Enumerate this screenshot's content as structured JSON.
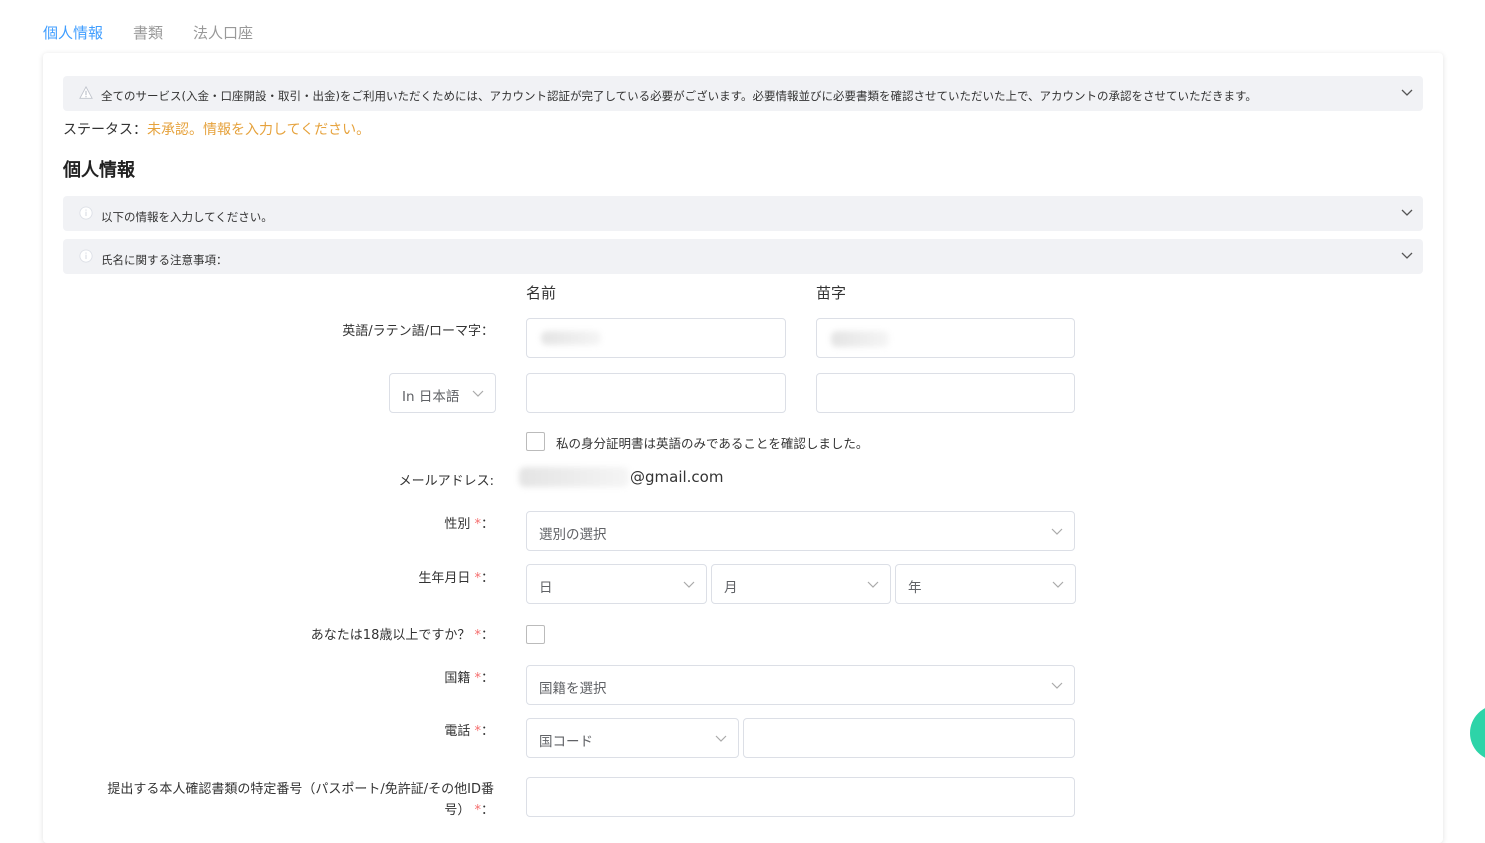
{
  "tabs": [
    {
      "label": "個人情報",
      "active": true
    },
    {
      "label": "書類",
      "active": false
    },
    {
      "label": "法人口座",
      "active": false
    }
  ],
  "notices": {
    "account": "全てのサービス(入金・口座開設・取引・出金)をご利用いただくためには、アカウント認証が完了している必要がございます。必要情報並びに必要書類を確認させていただいた上で、アカウントの承認をさせていただきます。",
    "info": "以下の情報を入力してください。",
    "name_caution": "氏名に関する注意事項："
  },
  "status": {
    "label": "ステータス：",
    "value": "未承認。情報を入力してください。"
  },
  "section_title": "個人情報",
  "form": {
    "col_first": "名前",
    "col_last": "苗字",
    "latin_label": "英語/ラテン語/ローマ字：",
    "lang_select": "In 日本語",
    "english_only_confirm": "私の身分証明書は英語のみであることを確認しました。",
    "email_label": "メールアドレス:",
    "email_value": "@gmail.com",
    "gender_label": "性別",
    "gender_placeholder": "選別の選択",
    "dob_label": "生年月日",
    "dob_day": "日",
    "dob_month": "月",
    "dob_year": "年",
    "age_label": "あなたは18歳以上ですか？",
    "nationality_label": "国籍",
    "nationality_placeholder": "国籍を選択",
    "phone_label": "電話",
    "phone_code_placeholder": "国コード",
    "id_number_label_1": "提出する本人確認書類の特定番号（パスポート/免許証/その他ID番",
    "id_number_label_2": "号）",
    "required_mark": "*",
    "colon": "："
  },
  "colors": {
    "accent": "#409eff",
    "status": "#e6a23c",
    "required": "#f56c6c",
    "fab": "#2dd4a8"
  }
}
